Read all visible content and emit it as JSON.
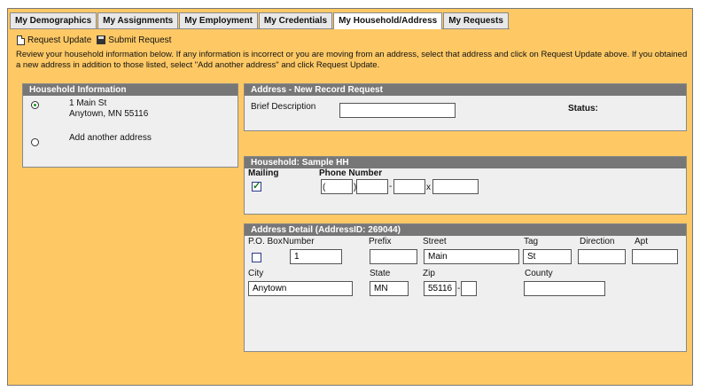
{
  "tabs": [
    "My Demographics",
    "My Assignments",
    "My Employment",
    "My Credentials",
    "My Household/Address",
    "My Requests"
  ],
  "active_tab_index": 4,
  "toolbar": {
    "request_update": "Request Update",
    "submit_request": "Submit Request"
  },
  "intro_text": "Review your household information below. If any information is incorrect or you are moving from an address, select that address and click on Request Update above. If you obtained a new address in addition to those listed, select \"Add another address\" and click Request Update.",
  "household_info": {
    "title": "Household Information",
    "address_line1": "1 Main St",
    "address_line2": "Anytown, MN 55116",
    "add_another": "Add another address",
    "selected": "address"
  },
  "new_record": {
    "title": "Address - New Record Request",
    "brief_description_label": "Brief Description",
    "brief_description_value": "",
    "status_label": "Status:"
  },
  "household": {
    "title": "Household: Sample HH",
    "mailing_label": "Mailing",
    "mailing_checked": true,
    "phone_label": "Phone Number",
    "phone_open": "(",
    "phone_close": ")",
    "phone_dash": "-",
    "phone_ext": "x"
  },
  "address_detail": {
    "title": "Address Detail (AddressID: 269044)",
    "po_box_label": "P.O. Box",
    "po_box_checked": false,
    "number_label": "Number",
    "number_value": "1",
    "prefix_label": "Prefix",
    "prefix_value": "",
    "street_label": "Street",
    "street_value": "Main",
    "tag_label": "Tag",
    "tag_value": "St",
    "direction_label": "Direction",
    "direction_value": "",
    "apt_label": "Apt",
    "apt_value": "",
    "city_label": "City",
    "city_value": "Anytown",
    "state_label": "State",
    "state_value": "MN",
    "zip_label": "Zip",
    "zip_value": "55116",
    "zip_sep": "-",
    "zip4_value": "",
    "county_label": "County",
    "county_value": ""
  }
}
